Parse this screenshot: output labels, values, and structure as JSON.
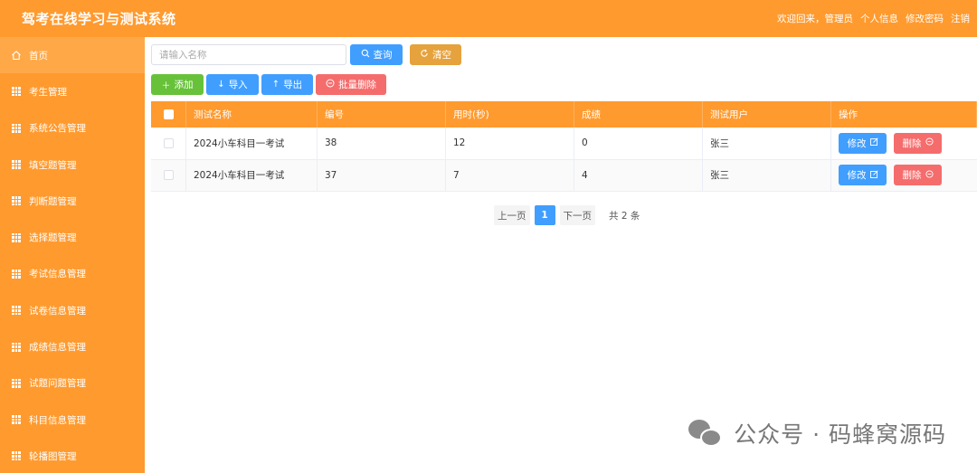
{
  "header": {
    "title": "驾考在线学习与测试系统",
    "welcome": "欢迎回来，管理员",
    "links": [
      "个人信息",
      "修改密码",
      "注销"
    ]
  },
  "sidebar": {
    "items": [
      {
        "label": "首页",
        "icon": "home-icon"
      },
      {
        "label": "考生管理",
        "icon": "grid-icon"
      },
      {
        "label": "系统公告管理",
        "icon": "grid-icon"
      },
      {
        "label": "填空题管理",
        "icon": "grid-icon"
      },
      {
        "label": "判断题管理",
        "icon": "grid-icon"
      },
      {
        "label": "选择题管理",
        "icon": "grid-icon"
      },
      {
        "label": "考试信息管理",
        "icon": "grid-icon"
      },
      {
        "label": "试卷信息管理",
        "icon": "grid-icon"
      },
      {
        "label": "成绩信息管理",
        "icon": "grid-icon"
      },
      {
        "label": "试题问题管理",
        "icon": "grid-icon"
      },
      {
        "label": "科目信息管理",
        "icon": "grid-icon"
      },
      {
        "label": "轮播图管理",
        "icon": "grid-icon"
      }
    ]
  },
  "search": {
    "placeholder": "请输入名称",
    "value": "",
    "query_label": "查询",
    "clear_label": "清空"
  },
  "actions": {
    "add_label": "添加",
    "import_label": "导入",
    "export_label": "导出",
    "batch_delete_label": "批量删除"
  },
  "table": {
    "columns": [
      "测试名称",
      "编号",
      "用时(秒)",
      "成绩",
      "测试用户",
      "操作"
    ],
    "rows": [
      {
        "name": "2024小车科目一考试",
        "id": "38",
        "time": "12",
        "score": "0",
        "user": "张三"
      },
      {
        "name": "2024小车科目一考试",
        "id": "37",
        "time": "7",
        "score": "4",
        "user": "张三"
      }
    ],
    "edit_label": "修改",
    "delete_label": "删除"
  },
  "pagination": {
    "prev_label": "上一页",
    "current_page": "1",
    "next_label": "下一页",
    "total_label": "共 2 条"
  },
  "watermark": {
    "text": "公众号 · 码蜂窝源码"
  },
  "colors": {
    "brand": "#ff9a2e",
    "primary": "#409eff",
    "success": "#67c23a",
    "warning": "#e6a23c",
    "danger": "#f56c6c"
  }
}
